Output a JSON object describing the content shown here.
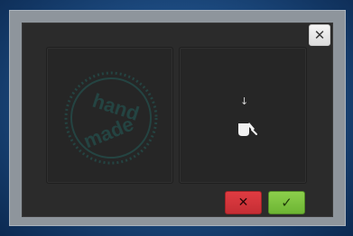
{
  "dialog": {
    "close_glyph": "✕"
  },
  "left_panel": {
    "stamp_words": [
      "hand",
      "made"
    ],
    "stamp_icon": "handmade-stamp-icon"
  },
  "right_panel": {
    "arrow_glyph": "↓",
    "drop_icon": "pour-icon"
  },
  "actions": {
    "cancel_glyph": "✕",
    "confirm_glyph": "✓"
  },
  "colors": {
    "background": "#1f4f86",
    "dialog": "#2b2b2b",
    "panel": "#262626",
    "cancel": "#d0353a",
    "confirm": "#7bc241",
    "stamp": "#244442"
  }
}
